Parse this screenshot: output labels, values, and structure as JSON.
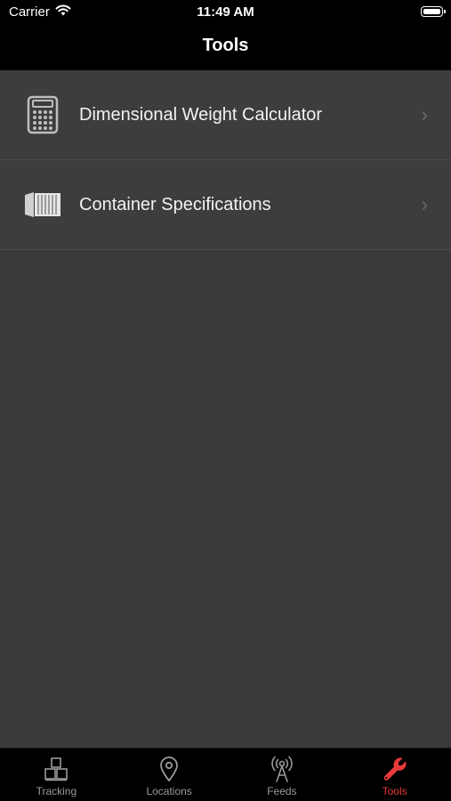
{
  "status_bar": {
    "carrier": "Carrier",
    "time": "11:49 AM"
  },
  "nav": {
    "title": "Tools"
  },
  "tools": [
    {
      "label": "Dimensional Weight Calculator",
      "icon": "calculator-icon"
    },
    {
      "label": "Container Specifications",
      "icon": "shipping-container-icon"
    }
  ],
  "tabbar": {
    "tabs": [
      {
        "label": "Tracking",
        "icon": "boxes-icon"
      },
      {
        "label": "Locations",
        "icon": "map-pin-icon"
      },
      {
        "label": "Feeds",
        "icon": "antenna-icon"
      },
      {
        "label": "Tools",
        "icon": "wrench-icon"
      }
    ],
    "active": "Tools",
    "accent_color": "#e8393b",
    "inactive_color": "#9a9a9a"
  }
}
